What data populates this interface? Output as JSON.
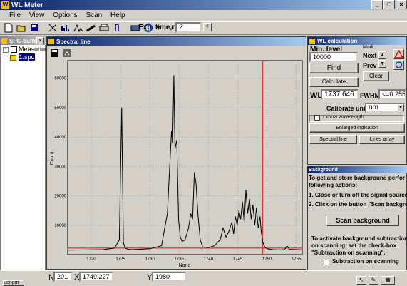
{
  "app": {
    "title": "WL Meter"
  },
  "menu": [
    "File",
    "View",
    "Options",
    "Scan",
    "Help"
  ],
  "toolbar": {
    "exp_label": "Exp. time,ms",
    "exp_value": "2",
    "plus_label": "+"
  },
  "spc_buffer": {
    "title": "SPC-buffer",
    "tree_root": "Measuring1",
    "tree_child": "1.spc"
  },
  "spectral_window": {
    "title": "Spectral line"
  },
  "statusbar": {
    "n_label": "N",
    "n_value": "201",
    "x_label": "X",
    "x_value": "1749.227",
    "y_label": "Y",
    "y_value": "1980"
  },
  "bottom_left": {
    "tab_label": "Length"
  },
  "wl_calc": {
    "title": "WL calculation",
    "min_level_label": "Min. level",
    "min_level_value": "10000",
    "find_label": "Find",
    "mark_label": "Mark",
    "next_label": "Next",
    "prev_label": "Prev",
    "clear_label": "Clear",
    "calculate_label": "Calculate",
    "wl_label": "WL",
    "wl_value": "1737.646",
    "fwhm_label": "FWHM",
    "fwhm_value": "<=0.255",
    "calib_label": "Calibrate unit",
    "calib_value": "nm",
    "know_wl_label": "I know wavelength",
    "enlarged_label": "Enlarged indication",
    "spectral_line_label": "Spectral line",
    "lines_array_label": "Lines array"
  },
  "background": {
    "title": "Background",
    "text1": "To get and store background perfor",
    "text2": "following actions:",
    "step1": "1. Close or turn off the signal source.",
    "step2": "2. Click on the button \"Scan backgrou",
    "scan_label": "Scan background",
    "text3": "To activate background subtraction",
    "text4": "on scanning, set the check-box",
    "text5": "\"Subtraction on scanning\".",
    "subtract_label": "Subtraction on scanning"
  },
  "chart_data": {
    "type": "line",
    "xlabel": "None",
    "ylabel": "Count",
    "xlim": [
      1716,
      1756
    ],
    "ylim": [
      0,
      66000
    ],
    "x_ticks": [
      1720,
      1725,
      1730,
      1735,
      1740,
      1745,
      1750,
      1755
    ],
    "y_ticks": [
      10000,
      20000,
      30000,
      40000,
      50000,
      60000
    ],
    "baseline": 2200,
    "cursor_x": 1749.227,
    "line_color": "#000000",
    "cursor_color": "#ff0000",
    "x": [
      1716,
      1722,
      1724,
      1724.8,
      1725.2,
      1725.5,
      1725.8,
      1726.3,
      1727,
      1730,
      1732,
      1733,
      1733.4,
      1733.7,
      1733.9,
      1734.1,
      1734.3,
      1734.6,
      1734.9,
      1735.2,
      1735.5,
      1736,
      1736.6,
      1737,
      1737.3,
      1737.6,
      1737.9,
      1738.2,
      1738.6,
      1739,
      1740,
      1741,
      1742,
      1742.5,
      1743,
      1743.5,
      1744,
      1744.3,
      1744.6,
      1744.9,
      1745.2,
      1745.5,
      1745.8,
      1746.1,
      1746.4,
      1746.7,
      1747,
      1747.3,
      1747.6,
      1747.9,
      1748.2,
      1748.5,
      1748.8,
      1749,
      1749.3,
      1749.6,
      1750,
      1751,
      1752,
      1753,
      1753.4,
      1753.8,
      1755,
      1756
    ],
    "y": [
      1500,
      1700,
      2200,
      5000,
      50000,
      4000,
      2200,
      1800,
      1700,
      2000,
      3000,
      14000,
      30000,
      42000,
      38000,
      61000,
      36000,
      39000,
      12000,
      6000,
      4500,
      5000,
      9000,
      14000,
      12000,
      28000,
      24000,
      14000,
      5000,
      2600,
      2400,
      3000,
      5000,
      9000,
      6000,
      8000,
      11000,
      7000,
      13000,
      10000,
      15000,
      12000,
      18000,
      11000,
      22000,
      14000,
      19000,
      12000,
      17000,
      10000,
      16000,
      9000,
      13000,
      8000,
      4000,
      2600,
      2000,
      1700,
      1600,
      1700,
      3000,
      1800,
      1700,
      1600
    ]
  }
}
